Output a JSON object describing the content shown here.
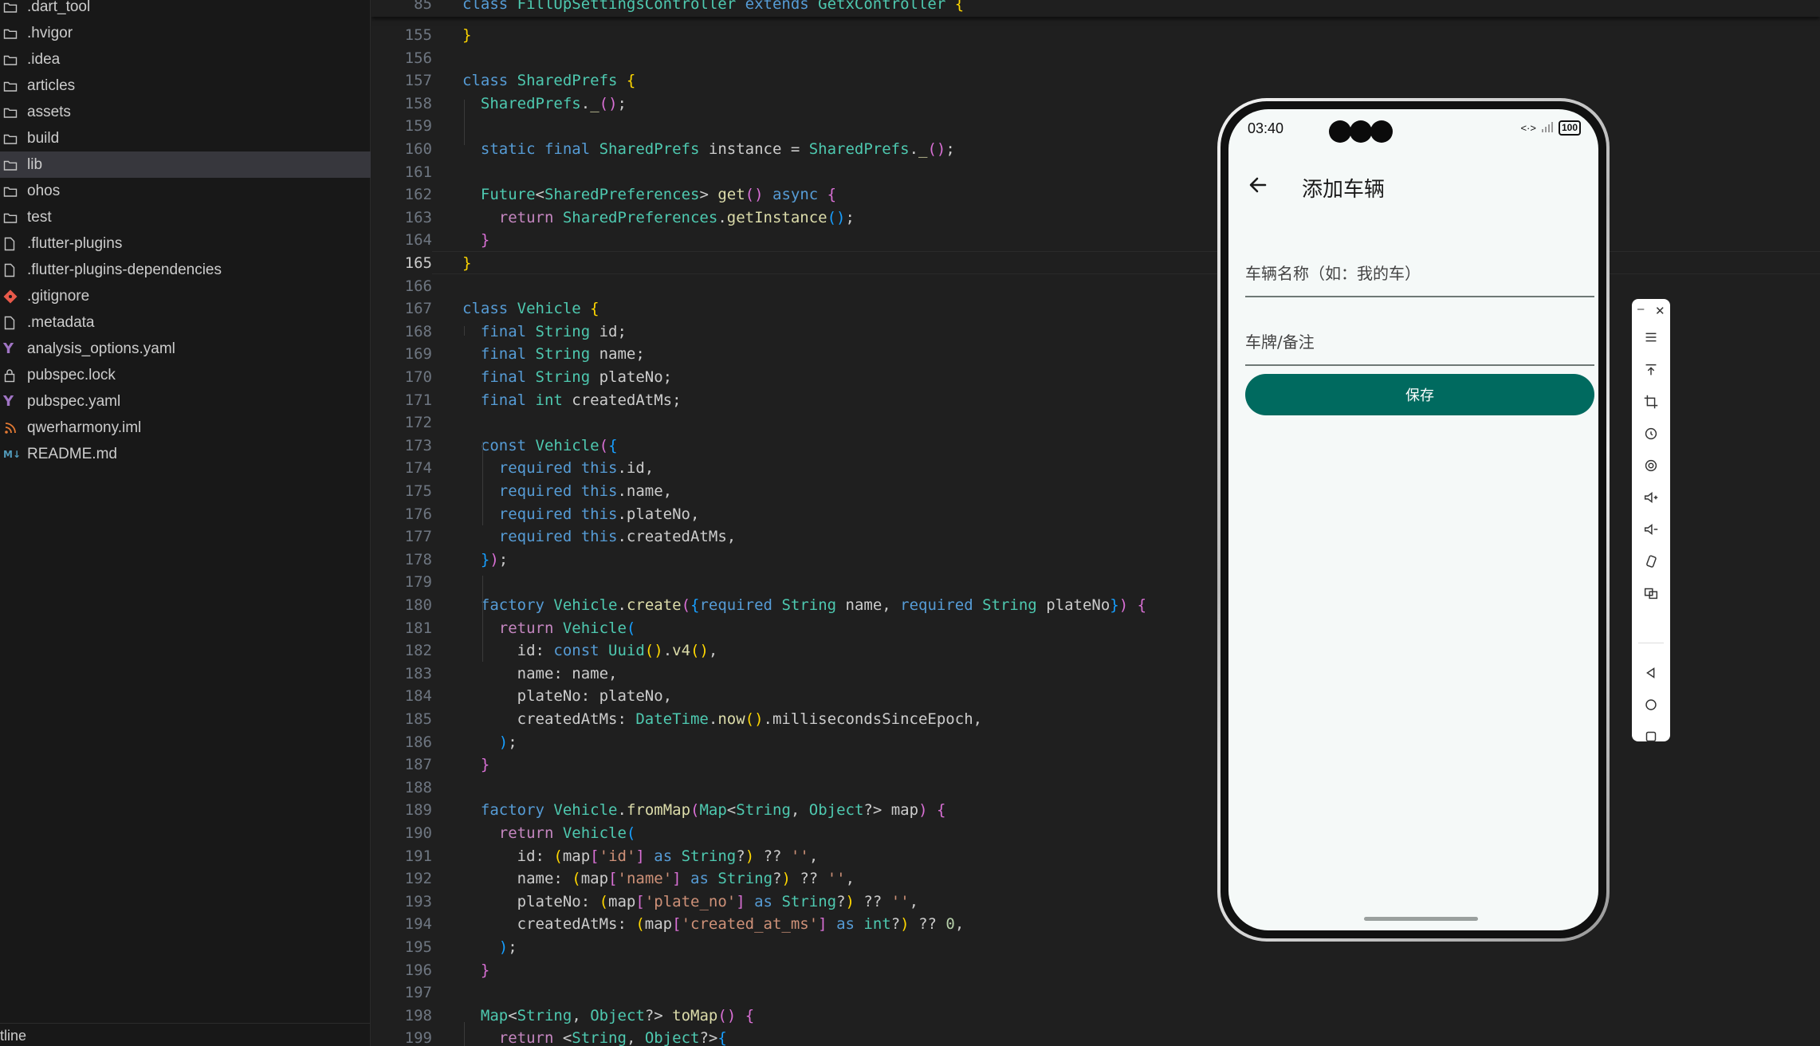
{
  "explorer": {
    "items": [
      {
        "label": ".dart_tool",
        "icon": "folder-icon"
      },
      {
        "label": ".hvigor",
        "icon": "folder-icon"
      },
      {
        "label": ".idea",
        "icon": "folder-icon"
      },
      {
        "label": "articles",
        "icon": "folder-icon"
      },
      {
        "label": "assets",
        "icon": "folder-icon"
      },
      {
        "label": "build",
        "icon": "folder-icon"
      },
      {
        "label": "lib",
        "icon": "folder-icon"
      },
      {
        "label": "ohos",
        "icon": "folder-icon"
      },
      {
        "label": "test",
        "icon": "folder-icon"
      },
      {
        "label": ".flutter-plugins",
        "icon": "file-icon"
      },
      {
        "label": ".flutter-plugins-dependencies",
        "icon": "file-icon"
      },
      {
        "label": ".gitignore",
        "icon": "git-icon"
      },
      {
        "label": ".metadata",
        "icon": "file-icon"
      },
      {
        "label": "analysis_options.yaml",
        "icon": "yaml-icon"
      },
      {
        "label": "pubspec.lock",
        "icon": "lock-icon"
      },
      {
        "label": "pubspec.yaml",
        "icon": "yaml-icon"
      },
      {
        "label": "qwerharmony.iml",
        "icon": "rss-icon"
      },
      {
        "label": "README.md",
        "icon": "markdown-icon"
      }
    ],
    "selected": "lib",
    "outline_label": "tline"
  },
  "editor": {
    "sticky": {
      "num": "85",
      "tokens": [
        [
          "kw",
          "class "
        ],
        [
          "ty",
          "FillUpSettingsController "
        ],
        [
          "kw",
          "extends "
        ],
        [
          "ty",
          "GetxController "
        ],
        [
          "b1",
          "{"
        ]
      ]
    },
    "current_line": "165",
    "lines": [
      {
        "num": "155",
        "tokens": [
          [
            "b1",
            "}"
          ]
        ]
      },
      {
        "num": "156",
        "tokens": []
      },
      {
        "num": "157",
        "tokens": [
          [
            "kw",
            "class "
          ],
          [
            "ty",
            "SharedPrefs "
          ],
          [
            "b1",
            "{"
          ]
        ]
      },
      {
        "num": "158",
        "tokens": [
          [
            "",
            "  "
          ],
          [
            "ty",
            "SharedPrefs"
          ],
          [
            "",
            "."
          ],
          [
            "fn",
            "_"
          ],
          [
            "b2",
            "()"
          ],
          [
            "",
            ";"
          ]
        ]
      },
      {
        "num": "159",
        "tokens": []
      },
      {
        "num": "160",
        "tokens": [
          [
            "",
            "  "
          ],
          [
            "kw",
            "static final "
          ],
          [
            "ty",
            "SharedPrefs "
          ],
          [
            "",
            "instance = "
          ],
          [
            "ty",
            "SharedPrefs"
          ],
          [
            "",
            "."
          ],
          [
            "fn",
            "_"
          ],
          [
            "b2",
            "()"
          ],
          [
            "",
            ";"
          ]
        ]
      },
      {
        "num": "161",
        "tokens": []
      },
      {
        "num": "162",
        "tokens": [
          [
            "",
            "  "
          ],
          [
            "ty",
            "Future"
          ],
          [
            "",
            "<"
          ],
          [
            "ty",
            "SharedPreferences"
          ],
          [
            "",
            "> "
          ],
          [
            "fn",
            "get"
          ],
          [
            "b2",
            "() "
          ],
          [
            "kw",
            "async "
          ],
          [
            "b2",
            "{"
          ]
        ]
      },
      {
        "num": "163",
        "tokens": [
          [
            "",
            "    "
          ],
          [
            "kc",
            "return "
          ],
          [
            "ty",
            "SharedPreferences"
          ],
          [
            "",
            "."
          ],
          [
            "fn",
            "getInstance"
          ],
          [
            "b3",
            "()"
          ],
          [
            "",
            ";"
          ]
        ]
      },
      {
        "num": "164",
        "tokens": [
          [
            "",
            "  "
          ],
          [
            "b2",
            "}"
          ]
        ]
      },
      {
        "num": "165",
        "tokens": [
          [
            "b1",
            "}"
          ]
        ]
      },
      {
        "num": "166",
        "tokens": []
      },
      {
        "num": "167",
        "tokens": [
          [
            "kw",
            "class "
          ],
          [
            "ty",
            "Vehicle "
          ],
          [
            "b1",
            "{"
          ]
        ]
      },
      {
        "num": "168",
        "tokens": [
          [
            "",
            "  "
          ],
          [
            "kw",
            "final "
          ],
          [
            "ty",
            "String "
          ],
          [
            "",
            "id;"
          ]
        ]
      },
      {
        "num": "169",
        "tokens": [
          [
            "",
            "  "
          ],
          [
            "kw",
            "final "
          ],
          [
            "ty",
            "String "
          ],
          [
            "",
            "name;"
          ]
        ]
      },
      {
        "num": "170",
        "tokens": [
          [
            "",
            "  "
          ],
          [
            "kw",
            "final "
          ],
          [
            "ty",
            "String "
          ],
          [
            "",
            "plateNo;"
          ]
        ]
      },
      {
        "num": "171",
        "tokens": [
          [
            "",
            "  "
          ],
          [
            "kw",
            "final "
          ],
          [
            "ty",
            "int "
          ],
          [
            "",
            "createdAtMs;"
          ]
        ]
      },
      {
        "num": "172",
        "tokens": []
      },
      {
        "num": "173",
        "tokens": [
          [
            "",
            "  "
          ],
          [
            "kw",
            "const "
          ],
          [
            "ty",
            "Vehicle"
          ],
          [
            "b2",
            "("
          ],
          [
            "b3",
            "{"
          ]
        ]
      },
      {
        "num": "174",
        "tokens": [
          [
            "",
            "    "
          ],
          [
            "kw",
            "required "
          ],
          [
            "kw",
            "this"
          ],
          [
            "",
            ".id,"
          ]
        ]
      },
      {
        "num": "175",
        "tokens": [
          [
            "",
            "    "
          ],
          [
            "kw",
            "required "
          ],
          [
            "kw",
            "this"
          ],
          [
            "",
            ".name,"
          ]
        ]
      },
      {
        "num": "176",
        "tokens": [
          [
            "",
            "    "
          ],
          [
            "kw",
            "required "
          ],
          [
            "kw",
            "this"
          ],
          [
            "",
            ".plateNo,"
          ]
        ]
      },
      {
        "num": "177",
        "tokens": [
          [
            "",
            "    "
          ],
          [
            "kw",
            "required "
          ],
          [
            "kw",
            "this"
          ],
          [
            "",
            ".createdAtMs,"
          ]
        ]
      },
      {
        "num": "178",
        "tokens": [
          [
            "",
            "  "
          ],
          [
            "b3",
            "}"
          ],
          [
            "b2",
            ")"
          ],
          [
            "",
            ";"
          ]
        ]
      },
      {
        "num": "179",
        "tokens": []
      },
      {
        "num": "180",
        "tokens": [
          [
            "",
            "  "
          ],
          [
            "kw",
            "factory "
          ],
          [
            "ty",
            "Vehicle"
          ],
          [
            "",
            "."
          ],
          [
            "fn",
            "create"
          ],
          [
            "b2",
            "("
          ],
          [
            "b3",
            "{"
          ],
          [
            "kw",
            "required "
          ],
          [
            "ty",
            "String "
          ],
          [
            "",
            "name, "
          ],
          [
            "kw",
            "required "
          ],
          [
            "ty",
            "String "
          ],
          [
            "",
            "plateNo"
          ],
          [
            "b3",
            "}"
          ],
          [
            "b2",
            ") {"
          ]
        ]
      },
      {
        "num": "181",
        "tokens": [
          [
            "",
            "    "
          ],
          [
            "kc",
            "return "
          ],
          [
            "ty",
            "Vehicle"
          ],
          [
            "b3",
            "("
          ]
        ]
      },
      {
        "num": "182",
        "tokens": [
          [
            "",
            "      id: "
          ],
          [
            "kw",
            "const "
          ],
          [
            "ty",
            "Uuid"
          ],
          [
            "b1",
            "()"
          ],
          [
            "",
            "."
          ],
          [
            "fn",
            "v4"
          ],
          [
            "b1",
            "()"
          ],
          [
            "",
            ","
          ]
        ]
      },
      {
        "num": "183",
        "tokens": [
          [
            "",
            "      name: name,"
          ]
        ]
      },
      {
        "num": "184",
        "tokens": [
          [
            "",
            "      plateNo: plateNo,"
          ]
        ]
      },
      {
        "num": "185",
        "tokens": [
          [
            "",
            "      createdAtMs: "
          ],
          [
            "ty",
            "DateTime"
          ],
          [
            "",
            "."
          ],
          [
            "fn",
            "now"
          ],
          [
            "b1",
            "()"
          ],
          [
            "",
            ".millisecondsSinceEpoch,"
          ]
        ]
      },
      {
        "num": "186",
        "tokens": [
          [
            "",
            "    "
          ],
          [
            "b3",
            ")"
          ],
          [
            "",
            ";"
          ]
        ]
      },
      {
        "num": "187",
        "tokens": [
          [
            "",
            "  "
          ],
          [
            "b2",
            "}"
          ]
        ]
      },
      {
        "num": "188",
        "tokens": []
      },
      {
        "num": "189",
        "tokens": [
          [
            "",
            "  "
          ],
          [
            "kw",
            "factory "
          ],
          [
            "ty",
            "Vehicle"
          ],
          [
            "",
            "."
          ],
          [
            "fn",
            "fromMap"
          ],
          [
            "b2",
            "("
          ],
          [
            "ty",
            "Map"
          ],
          [
            "",
            "<"
          ],
          [
            "ty",
            "String"
          ],
          [
            "",
            ", "
          ],
          [
            "ty",
            "Object"
          ],
          [
            "",
            "?> map"
          ],
          [
            "b2",
            ") {"
          ]
        ]
      },
      {
        "num": "190",
        "tokens": [
          [
            "",
            "    "
          ],
          [
            "kc",
            "return "
          ],
          [
            "ty",
            "Vehicle"
          ],
          [
            "b3",
            "("
          ]
        ]
      },
      {
        "num": "191",
        "tokens": [
          [
            "",
            "      id: "
          ],
          [
            "b1",
            "("
          ],
          [
            "",
            "map"
          ],
          [
            "b2",
            "["
          ],
          [
            "st",
            "'id'"
          ],
          [
            "b2",
            "] "
          ],
          [
            "kw",
            "as "
          ],
          [
            "ty",
            "String"
          ],
          [
            "",
            "?"
          ],
          [
            "b1",
            ") "
          ],
          [
            "",
            "?? "
          ],
          [
            "st",
            "''"
          ],
          [
            "",
            ","
          ]
        ]
      },
      {
        "num": "192",
        "tokens": [
          [
            "",
            "      name: "
          ],
          [
            "b1",
            "("
          ],
          [
            "",
            "map"
          ],
          [
            "b2",
            "["
          ],
          [
            "st",
            "'name'"
          ],
          [
            "b2",
            "] "
          ],
          [
            "kw",
            "as "
          ],
          [
            "ty",
            "String"
          ],
          [
            "",
            "?"
          ],
          [
            "b1",
            ") "
          ],
          [
            "",
            "?? "
          ],
          [
            "st",
            "''"
          ],
          [
            "",
            ","
          ]
        ]
      },
      {
        "num": "193",
        "tokens": [
          [
            "",
            "      plateNo: "
          ],
          [
            "b1",
            "("
          ],
          [
            "",
            "map"
          ],
          [
            "b2",
            "["
          ],
          [
            "st",
            "'plate_no'"
          ],
          [
            "b2",
            "] "
          ],
          [
            "kw",
            "as "
          ],
          [
            "ty",
            "String"
          ],
          [
            "",
            "?"
          ],
          [
            "b1",
            ") "
          ],
          [
            "",
            "?? "
          ],
          [
            "st",
            "''"
          ],
          [
            "",
            ","
          ]
        ]
      },
      {
        "num": "194",
        "tokens": [
          [
            "",
            "      createdAtMs: "
          ],
          [
            "b1",
            "("
          ],
          [
            "",
            "map"
          ],
          [
            "b2",
            "["
          ],
          [
            "st",
            "'created_at_ms'"
          ],
          [
            "b2",
            "] "
          ],
          [
            "kw",
            "as "
          ],
          [
            "ty",
            "int"
          ],
          [
            "",
            "?"
          ],
          [
            "b1",
            ") "
          ],
          [
            "",
            "?? "
          ],
          [
            "nu",
            "0"
          ],
          [
            "",
            ","
          ]
        ]
      },
      {
        "num": "195",
        "tokens": [
          [
            "",
            "    "
          ],
          [
            "b3",
            ")"
          ],
          [
            "",
            ";"
          ]
        ]
      },
      {
        "num": "196",
        "tokens": [
          [
            "",
            "  "
          ],
          [
            "b2",
            "}"
          ]
        ]
      },
      {
        "num": "197",
        "tokens": []
      },
      {
        "num": "198",
        "tokens": [
          [
            "",
            "  "
          ],
          [
            "ty",
            "Map"
          ],
          [
            "",
            "<"
          ],
          [
            "ty",
            "String"
          ],
          [
            "",
            ", "
          ],
          [
            "ty",
            "Object"
          ],
          [
            "",
            "?> "
          ],
          [
            "fn",
            "toMap"
          ],
          [
            "b2",
            "() {"
          ]
        ]
      },
      {
        "num": "199",
        "tokens": [
          [
            "",
            "    "
          ],
          [
            "kc",
            "return "
          ],
          [
            "",
            "<"
          ],
          [
            "ty",
            "String"
          ],
          [
            "",
            ", "
          ],
          [
            "ty",
            "Object"
          ],
          [
            "",
            "?>"
          ],
          [
            "b3",
            "{"
          ]
        ]
      }
    ]
  },
  "phone": {
    "time": "03:40",
    "battery": "100",
    "title": "添加车辆",
    "name_placeholder": "车辆名称（如：我的车）",
    "plate_placeholder": "车牌/备注",
    "save_label": "保存"
  },
  "toolbar": {
    "buttons": [
      "menu-icon",
      "pin-top-icon",
      "crop-icon",
      "rotate-icon",
      "screenshot-icon",
      "volume-up-icon",
      "volume-down-icon",
      "shake-icon",
      "multi-window-icon",
      "back-nav-icon",
      "home-nav-icon",
      "recents-nav-icon"
    ]
  },
  "colors": {
    "accent": "#006a5f",
    "editor_bg": "#1f1f1f",
    "sidebar_bg": "#181818"
  }
}
